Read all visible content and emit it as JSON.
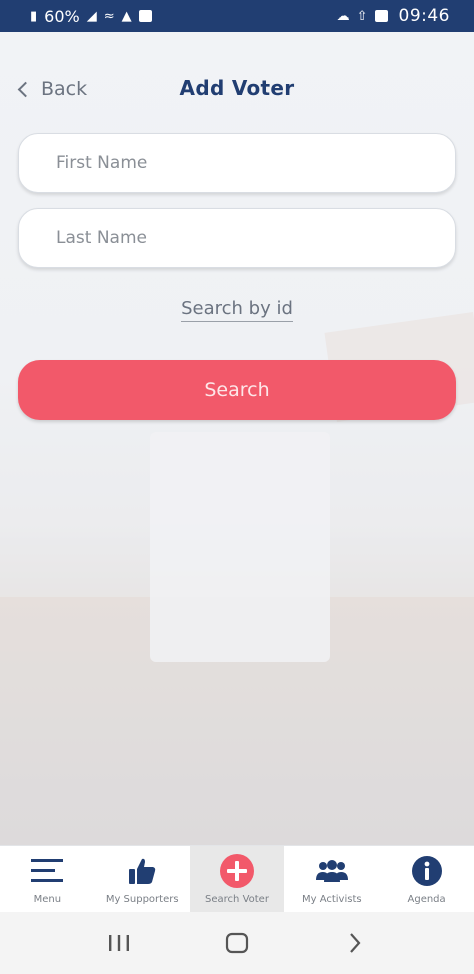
{
  "status_bar": {
    "battery": "60%",
    "time": "09:46"
  },
  "header": {
    "back_label": "Back",
    "title": "Add Voter"
  },
  "form": {
    "first_name": {
      "value": "",
      "placeholder": "First Name"
    },
    "last_name": {
      "value": "",
      "placeholder": "Last Name"
    },
    "search_by_id": "Search by id",
    "search_button": "Search"
  },
  "tab_bar": {
    "items": [
      {
        "label": "Menu",
        "icon": "menu-icon"
      },
      {
        "label": "My Supporters",
        "icon": "thumbs-up-icon"
      },
      {
        "label": "Search Voter",
        "icon": "plus-circle-icon",
        "active": true
      },
      {
        "label": "My Activists",
        "icon": "group-icon"
      },
      {
        "label": "Agenda",
        "icon": "info-icon"
      }
    ]
  },
  "colors": {
    "primary": "#213e72",
    "accent": "#f2596a",
    "active_tab": "#e8e8e8"
  }
}
